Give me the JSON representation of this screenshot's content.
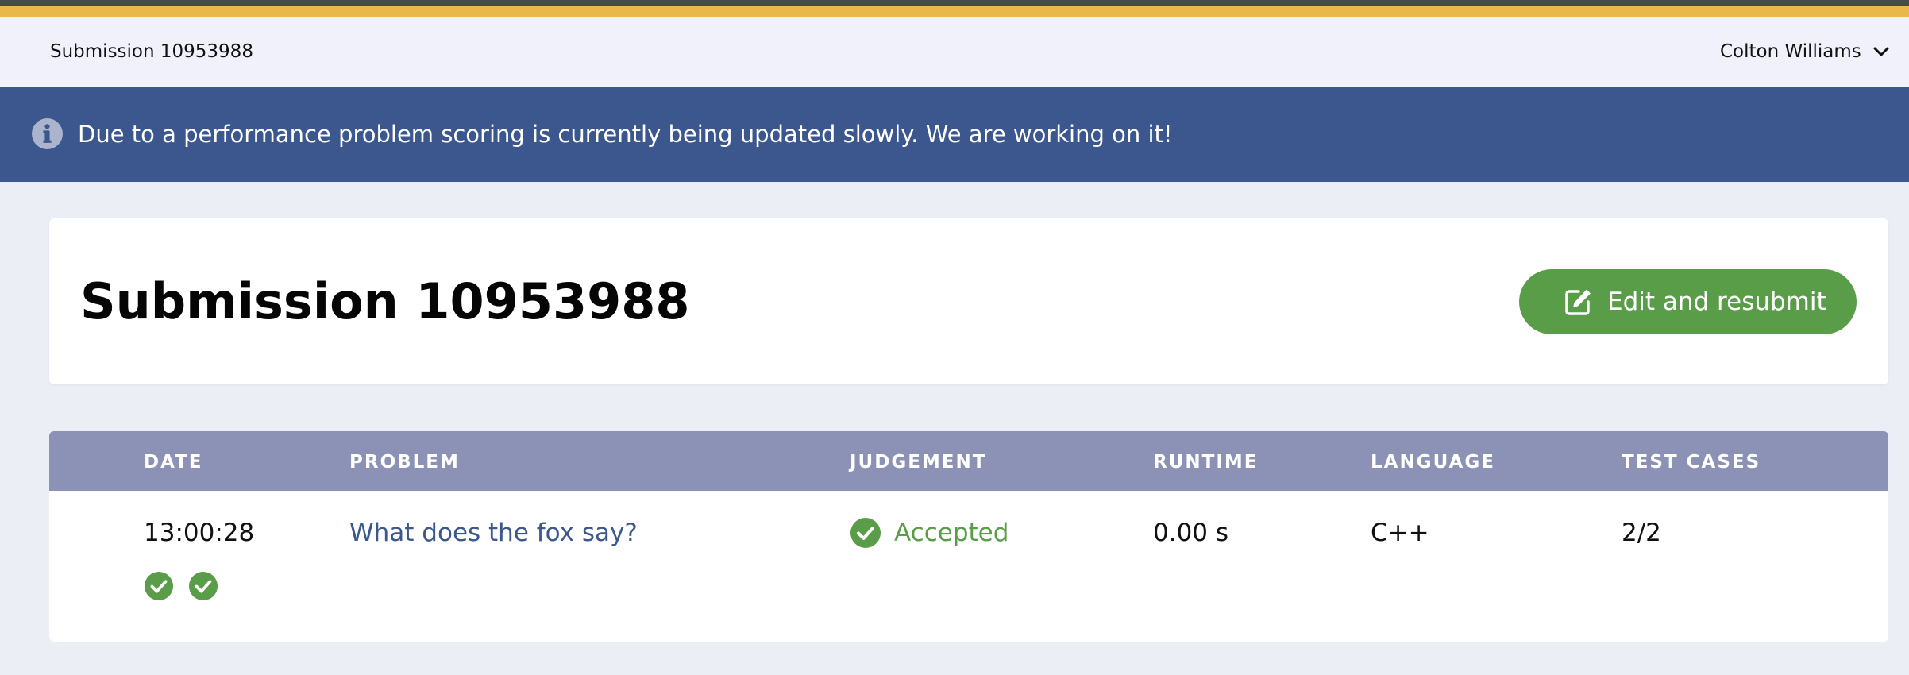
{
  "header": {
    "title": "Submission 10953988",
    "user_name": "Colton Williams"
  },
  "banner": {
    "icon": "info-icon",
    "message": "Due to a performance problem scoring is currently being updated slowly. We are working on it!"
  },
  "page": {
    "title": "Submission 10953988",
    "edit_button_label": "Edit and resubmit",
    "edit_button_icon": "edit-icon"
  },
  "table": {
    "headers": [
      "DATE",
      "PROBLEM",
      "JUDGEMENT",
      "RUNTIME",
      "LANGUAGE",
      "TEST CASES"
    ],
    "row": {
      "date": "13:00:28",
      "problem": "What does the fox say?",
      "judgement": "Accepted",
      "runtime": "0.00 s",
      "language": "C++",
      "test_cases": "2/2",
      "test_case_results": [
        "accepted",
        "accepted"
      ]
    }
  },
  "colors": {
    "accent_top": "#e8b84a",
    "banner": "#3b578d",
    "success": "#5a9d49",
    "table_header": "#8c92b6",
    "link": "#3b578d"
  }
}
